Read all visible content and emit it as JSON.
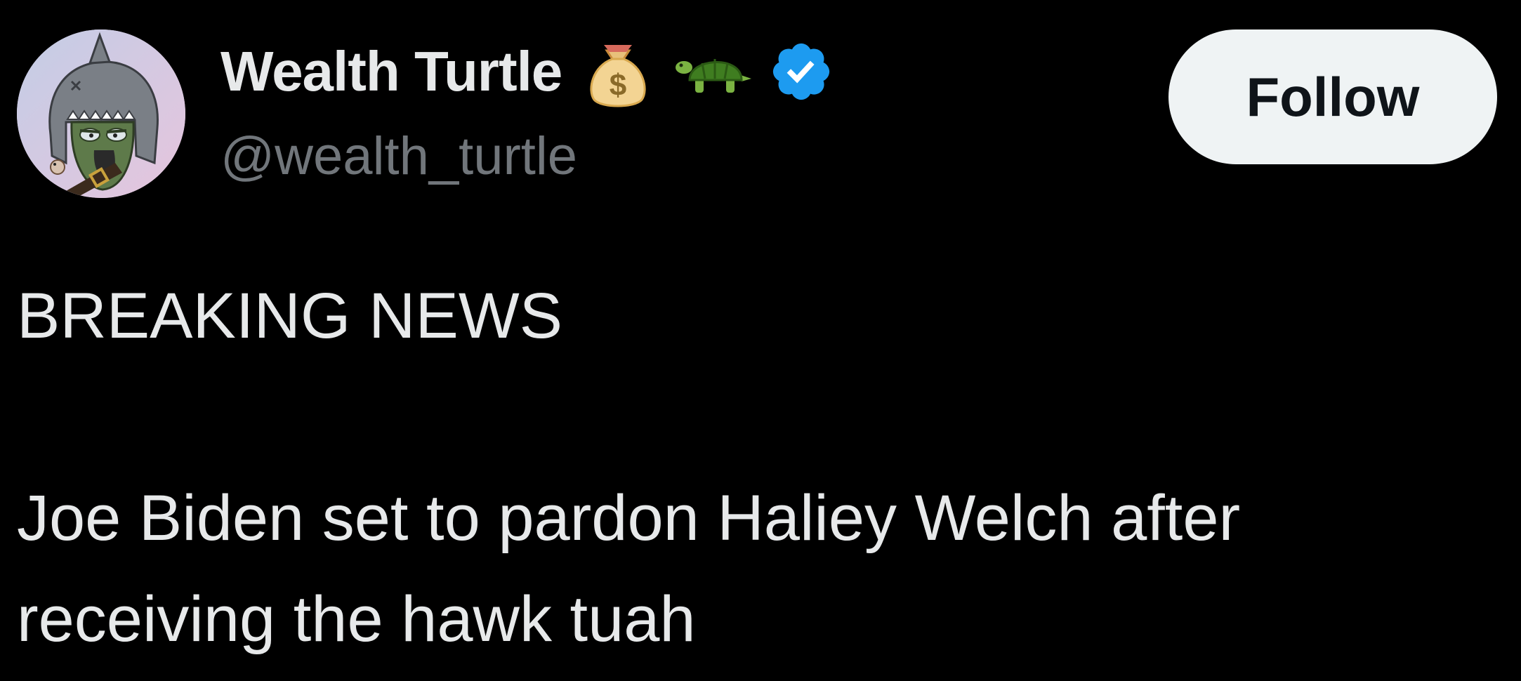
{
  "author": {
    "display_name": "Wealth Turtle",
    "handle": "@wealth_turtle",
    "badges": [
      "money-bag-icon",
      "turtle-icon",
      "verified-badge-icon"
    ],
    "verified_color": "#1d9bf0"
  },
  "actions": {
    "follow_label": "Follow"
  },
  "tweet": {
    "lines": [
      "BREAKING NEWS",
      "",
      "Joe Biden set to pardon Haliey Welch after",
      "receiving the hawk tuah"
    ]
  },
  "colors": {
    "background": "#000000",
    "text_primary": "#e7e9ea",
    "text_secondary": "#71767b",
    "button_bg": "#eff3f4",
    "button_text": "#0f1419"
  }
}
